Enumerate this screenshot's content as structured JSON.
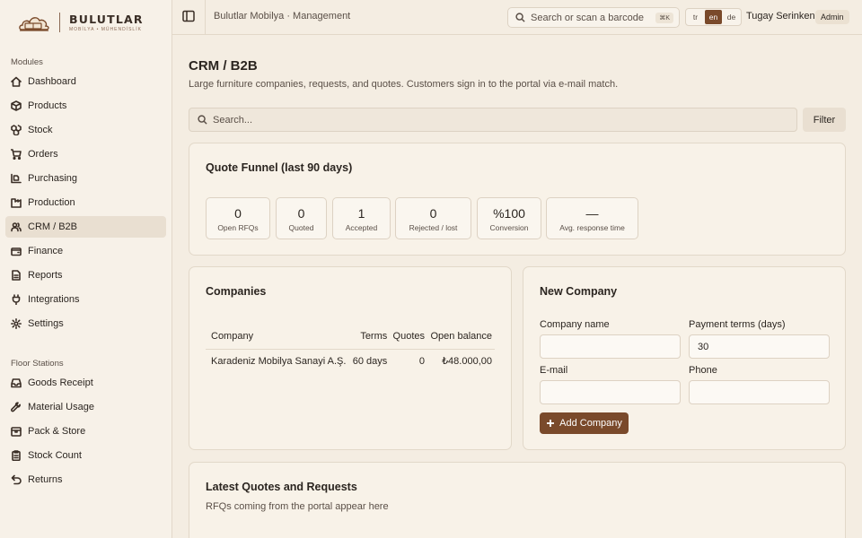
{
  "brand": {
    "title": "BULUTLAR",
    "subtitle": "MOBİLYA • MÜHENDİSLİK"
  },
  "sidebar": {
    "modules_title": "Modules",
    "modules": [
      {
        "label": "Dashboard",
        "icon": "dashboard-icon"
      },
      {
        "label": "Products",
        "icon": "box-icon"
      },
      {
        "label": "Stock",
        "icon": "boxes-icon"
      },
      {
        "label": "Orders",
        "icon": "cart-icon"
      },
      {
        "label": "Purchasing",
        "icon": "truck-icon"
      },
      {
        "label": "Production",
        "icon": "factory-icon"
      },
      {
        "label": "CRM / B2B",
        "icon": "users-icon",
        "active": true
      },
      {
        "label": "Finance",
        "icon": "wallet-icon"
      },
      {
        "label": "Reports",
        "icon": "file-text-icon"
      },
      {
        "label": "Integrations",
        "icon": "plug-icon"
      },
      {
        "label": "Settings",
        "icon": "gear-icon"
      }
    ],
    "floor_title": "Floor Stations",
    "floor": [
      {
        "label": "Goods Receipt",
        "icon": "inbox-icon"
      },
      {
        "label": "Material Usage",
        "icon": "wrench-icon"
      },
      {
        "label": "Pack & Store",
        "icon": "package-icon"
      },
      {
        "label": "Stock Count",
        "icon": "clipboard-icon"
      },
      {
        "label": "Returns",
        "icon": "undo-icon"
      }
    ]
  },
  "topbar": {
    "breadcrumb": "Bulutlar Mobilya · Management",
    "search_placeholder": "Search or scan a barcode",
    "shortcut": "⌘K",
    "languages": [
      "tr",
      "en",
      "de"
    ],
    "active_language": "en",
    "user_name": "Tugay Serinken",
    "user_role": "Admin"
  },
  "page": {
    "title": "CRM / B2B",
    "description": "Large furniture companies, requests, and quotes. Customers sign in to the portal via e-mail match.",
    "search_placeholder": "Search...",
    "filter_label": "Filter"
  },
  "funnel": {
    "title": "Quote Funnel (last 90 days)",
    "stats": [
      {
        "value": "0",
        "label": "Open RFQs"
      },
      {
        "value": "0",
        "label": "Quoted"
      },
      {
        "value": "1",
        "label": "Accepted"
      },
      {
        "value": "0",
        "label": "Rejected / lost"
      },
      {
        "value": "%100",
        "label": "Conversion"
      },
      {
        "value": "—",
        "label": "Avg. response time"
      }
    ]
  },
  "companies": {
    "title": "Companies",
    "columns": [
      "Company",
      "Terms",
      "Quotes",
      "Open balance"
    ],
    "rows": [
      [
        "Karadeniz Mobilya Sanayi A.Ş.",
        "60 days",
        "0",
        "₺48.000,00"
      ]
    ]
  },
  "new_company": {
    "title": "New Company",
    "name_label": "Company name",
    "name_value": "",
    "terms_label": "Payment terms (days)",
    "terms_value": "30",
    "email_label": "E-mail",
    "email_value": "",
    "phone_label": "Phone",
    "phone_value": "",
    "submit_label": "Add Company"
  },
  "latest": {
    "title": "Latest Quotes and Requests",
    "subtitle": "RFQs coming from the portal appear here"
  },
  "colors": {
    "accent": "#7a4a2b",
    "background": "#f4ede2",
    "card": "#f8f2e8"
  }
}
